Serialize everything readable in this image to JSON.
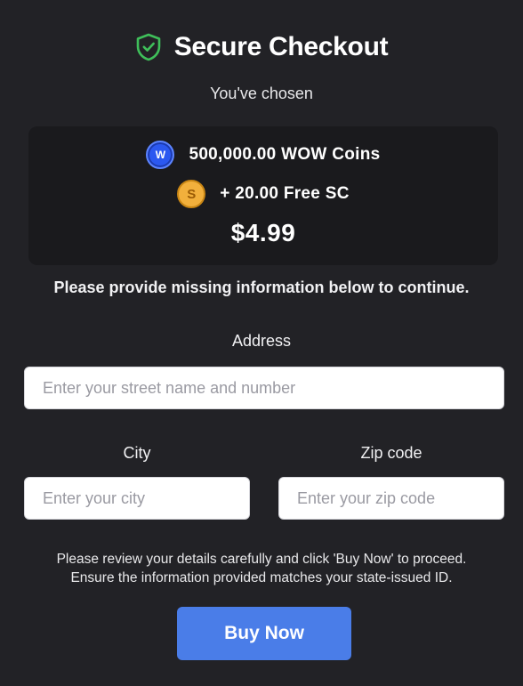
{
  "header": {
    "icon": "shield-check-icon",
    "title": "Secure Checkout",
    "accent_color": "#3fbf5a"
  },
  "chosen_label": "You've chosen",
  "summary": {
    "items": [
      {
        "icon": "wow-coin-icon",
        "badge": "W",
        "text": "500,000.00 WOW Coins"
      },
      {
        "icon": "sweeps-coin-icon",
        "badge": "S",
        "text": "+ 20.00 Free SC"
      }
    ],
    "price": "$4.99"
  },
  "notice": "Please provide missing information below to continue.",
  "form": {
    "address": {
      "label": "Address",
      "value": "",
      "placeholder": "Enter your street name and number"
    },
    "city": {
      "label": "City",
      "value": "",
      "placeholder": "Enter your city"
    },
    "zip": {
      "label": "Zip code",
      "value": "",
      "placeholder": "Enter your zip code"
    }
  },
  "review": {
    "line1": "Please review your details carefully and click 'Buy Now' to proceed.",
    "line2": "Ensure the information provided matches your state-issued ID."
  },
  "buy_button": {
    "label": "Buy Now",
    "color": "#4a7de8"
  }
}
